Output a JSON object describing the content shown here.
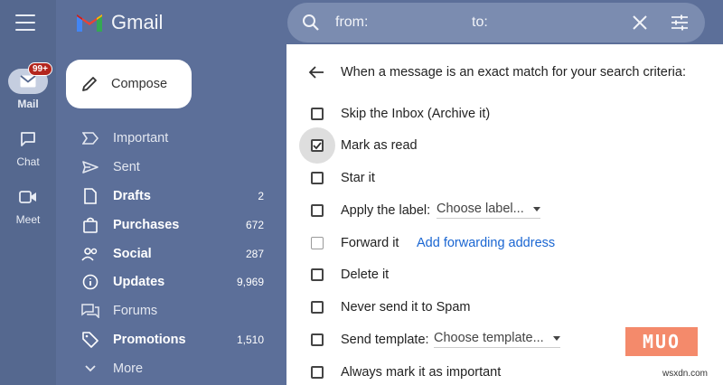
{
  "app": {
    "name": "Gmail"
  },
  "rail": {
    "items": [
      {
        "label": "Mail",
        "badge": "99+",
        "icon": "mail-icon"
      },
      {
        "label": "Chat",
        "icon": "chat-icon"
      },
      {
        "label": "Meet",
        "icon": "video-icon"
      }
    ]
  },
  "compose": {
    "label": "Compose"
  },
  "nav": {
    "items": [
      {
        "label": "Important",
        "count": "",
        "icon": "important-icon"
      },
      {
        "label": "Sent",
        "count": "",
        "icon": "send-icon"
      },
      {
        "label": "Drafts",
        "count": "2",
        "icon": "draft-icon"
      },
      {
        "label": "Purchases",
        "count": "672",
        "icon": "shopping-bag-icon"
      },
      {
        "label": "Social",
        "count": "287",
        "icon": "people-icon"
      },
      {
        "label": "Updates",
        "count": "9,969",
        "icon": "info-icon"
      },
      {
        "label": "Forums",
        "count": "",
        "icon": "forum-icon"
      },
      {
        "label": "Promotions",
        "count": "1,510",
        "icon": "tag-icon"
      },
      {
        "label": "More",
        "count": "",
        "icon": "chevron-down-icon"
      }
    ]
  },
  "search": {
    "from_label": "from:",
    "to_label": "to:"
  },
  "filter": {
    "heading": "When a message is an exact match for your search criteria:",
    "options": [
      {
        "label": "Skip the Inbox (Archive it)",
        "checked": false
      },
      {
        "label": "Mark as read",
        "checked": true
      },
      {
        "label": "Star it",
        "checked": false
      },
      {
        "label": "Apply the label:",
        "checked": false,
        "dropdown": "Choose label..."
      },
      {
        "label": "Forward it",
        "checked": false,
        "link": "Add forwarding address"
      },
      {
        "label": "Delete it",
        "checked": false
      },
      {
        "label": "Never send it to Spam",
        "checked": false
      },
      {
        "label": "Send template:",
        "checked": false,
        "dropdown": "Choose template..."
      },
      {
        "label": "Always mark it as important",
        "checked": false
      }
    ]
  },
  "watermark": {
    "brand": "MUO",
    "site": "wsxdn.com"
  },
  "colors": {
    "background": "#5c6f99",
    "accent_link": "#1a66d2",
    "badge": "#b3261e"
  }
}
